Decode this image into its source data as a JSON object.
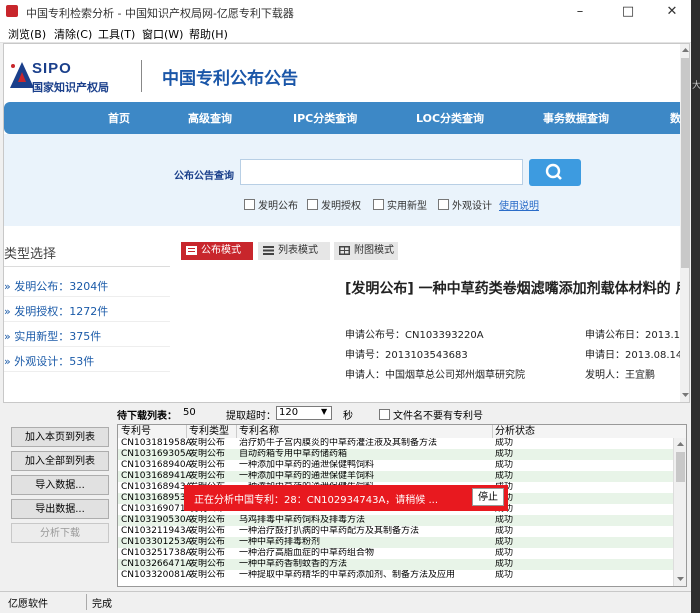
{
  "window": {
    "title": "中国专利检索分析 - 中国知识产权局网-亿愿专利下载器"
  },
  "menu": [
    "浏览(B)",
    "清除(C)",
    "工具(T)",
    "窗口(W)",
    "帮助(H)"
  ],
  "site": {
    "logo_abbr": "SIPO",
    "logo_cn": "国家知识产权局",
    "title": "中国专利公布公告",
    "nav": [
      "首页",
      "高级查询",
      "IPC分类查询",
      "LOC分类查询",
      "事务数据查询",
      "数"
    ],
    "search_label": "公布公告查询",
    "search_value": "",
    "checkboxes": [
      "发明公布",
      "发明授权",
      "实用新型",
      "外观设计"
    ],
    "help_link": "使用说明"
  },
  "left_panel": {
    "title": "类型选择",
    "items": [
      "发明公布：3204件",
      "发明授权：1272件",
      "实用新型：375件",
      "外观设计：53件"
    ]
  },
  "modes": [
    "公布模式",
    "列表模式",
    "附图模式"
  ],
  "doc": {
    "title": "[发明公布] 一种中草药类卷烟滤嘴添加剂载体材料的 用",
    "fields": {
      "pub_no": "申请公布号：CN103393220A",
      "pub_date": "申请公布日：2013.1",
      "app_no": "申请号：2013103543683",
      "app_date": "申请日：2013.08.14",
      "applicant": "申请人：中国烟草总公司郑州烟草研究院",
      "inventor": "发明人：王宜鹏"
    }
  },
  "lower": {
    "buttons": [
      "加入本页到列表",
      "加入全部到列表",
      "导入数据...",
      "导出数据...",
      "分析下载"
    ],
    "queue_label": "待下载列表：",
    "queue_count": "50",
    "timeout_label": "提取超时：",
    "timeout_value": "120",
    "sec_label": "秒",
    "filename_option": "文件名不要有专利号",
    "columns": [
      "专利号",
      "专利类型",
      "专利名称",
      "分析状态"
    ],
    "rows": [
      {
        "no": "CN103181958A",
        "type": "发明公布",
        "name": "治疗奶牛子宫内膜炎的中草药灌注液及其制备方法",
        "status": "成功"
      },
      {
        "no": "CN103169305A",
        "type": "发明公布",
        "name": "自动药箱专用中草药储药箱",
        "status": "成功"
      },
      {
        "no": "CN103168940A",
        "type": "发明公布",
        "name": "一种添加中草药的通泄保健鸭饲料",
        "status": "成功"
      },
      {
        "no": "CN103168941A",
        "type": "发明公布",
        "name": "一种添加中草药的通泄保健羊饲料",
        "status": "成功"
      },
      {
        "no": "CN103168943A",
        "type": "发明公布",
        "name": "一种添加中草药的通泄保健牛饲料",
        "status": "成功"
      },
      {
        "no": "CN103168953A",
        "type": "发明公布",
        "name": "",
        "status": "成功"
      },
      {
        "no": "CN103169071A",
        "type": "发明公布",
        "name": "",
        "status": "成功"
      },
      {
        "no": "CN103190530A",
        "type": "发明公布",
        "name": "乌鸡排毒中草药饲料及排毒方法",
        "status": "成功"
      },
      {
        "no": "CN103211943A",
        "type": "发明公布",
        "name": "一种治疗鼓打扒病的中草药配方及其制备方法",
        "status": "成功"
      },
      {
        "no": "CN103301253A",
        "type": "发明公布",
        "name": "一种中草药排毒粉剂",
        "status": "成功"
      },
      {
        "no": "CN103251738A",
        "type": "发明公布",
        "name": "一种治疗高脂血症的中草药组合物",
        "status": "成功"
      },
      {
        "no": "CN103266471A",
        "type": "发明公布",
        "name": "一种中草药香制蚊香的方法",
        "status": "成功"
      },
      {
        "no": "CN103320081A",
        "type": "发明公布",
        "name": "一种提取中草药精华的中草药添加剂、制备方法及应用",
        "status": "成功"
      }
    ],
    "overlay_text": "正在分析中国专利：28：CN102934743A，请稍候 ...",
    "stop_label": "停止"
  },
  "status": {
    "left": "亿愿软件",
    "right": "完成"
  },
  "right_edge_glyph": "大",
  "colors": {
    "accent_red": "#e8191f",
    "nav_blue": "#3d88c6",
    "brand_blue": "#1a56a8"
  }
}
